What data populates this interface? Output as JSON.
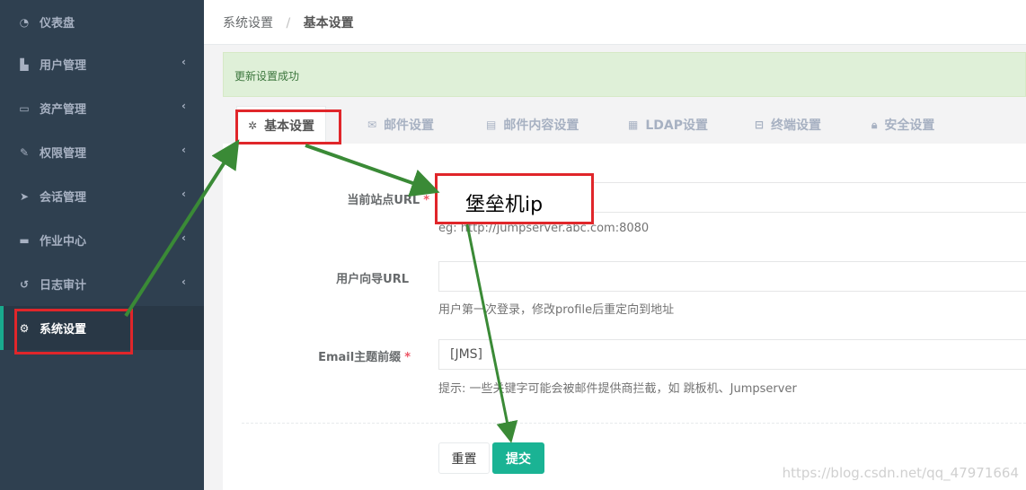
{
  "sidebar": {
    "items": [
      {
        "label": "仪表盘",
        "icon": "dashboard-icon",
        "chevron": false
      },
      {
        "label": "用户管理",
        "icon": "users-icon",
        "chevron": true
      },
      {
        "label": "资产管理",
        "icon": "inbox-icon",
        "chevron": true
      },
      {
        "label": "权限管理",
        "icon": "edit-icon",
        "chevron": true
      },
      {
        "label": "会话管理",
        "icon": "rocket-icon",
        "chevron": true
      },
      {
        "label": "作业中心",
        "icon": "coffee-icon",
        "chevron": true
      },
      {
        "label": "日志审计",
        "icon": "history-icon",
        "chevron": true
      },
      {
        "label": "系统设置",
        "icon": "cogs-icon",
        "chevron": false,
        "active": true
      }
    ],
    "chevron_glyph": "‹"
  },
  "breadcrumb": {
    "parent": "系统设置",
    "separator": "/",
    "current": "基本设置"
  },
  "alert": {
    "message": "更新设置成功"
  },
  "tabs": [
    {
      "label": "基本设置",
      "icon": "cubes-icon",
      "active": true
    },
    {
      "label": "邮件设置",
      "icon": "envelope-icon"
    },
    {
      "label": "邮件内容设置",
      "icon": "file-text-icon"
    },
    {
      "label": "LDAP设置",
      "icon": "server-icon"
    },
    {
      "label": "终端设置",
      "icon": "hdd-icon"
    },
    {
      "label": "安全设置",
      "icon": "lock-icon"
    }
  ],
  "form": {
    "site_url": {
      "label": "当前站点URL",
      "required": "*",
      "value": "",
      "help": "eg: http://jumpserver.abc.com:8080"
    },
    "user_guide_url": {
      "label": "用户向导URL",
      "value": "",
      "help": "用户第一次登录，修改profile后重定向到地址"
    },
    "email_subject_prefix": {
      "label": "Email主题前缀",
      "required": "*",
      "value": "[JMS]",
      "help": "提示: 一些关键字可能会被邮件提供商拦截，如 跳板机、Jumpserver"
    },
    "reset_label": "重置",
    "submit_label": "提交"
  },
  "annotation": {
    "callout_text": "堡垒机ip",
    "highlight_color": "#e0262a",
    "arrow_color": "#3a8a36"
  },
  "watermark": "https://blog.csdn.net/qq_47971664",
  "colors": {
    "sidebar_bg": "#2f4050",
    "accent": "#1ab394",
    "alert_bg": "#dff0d8"
  }
}
